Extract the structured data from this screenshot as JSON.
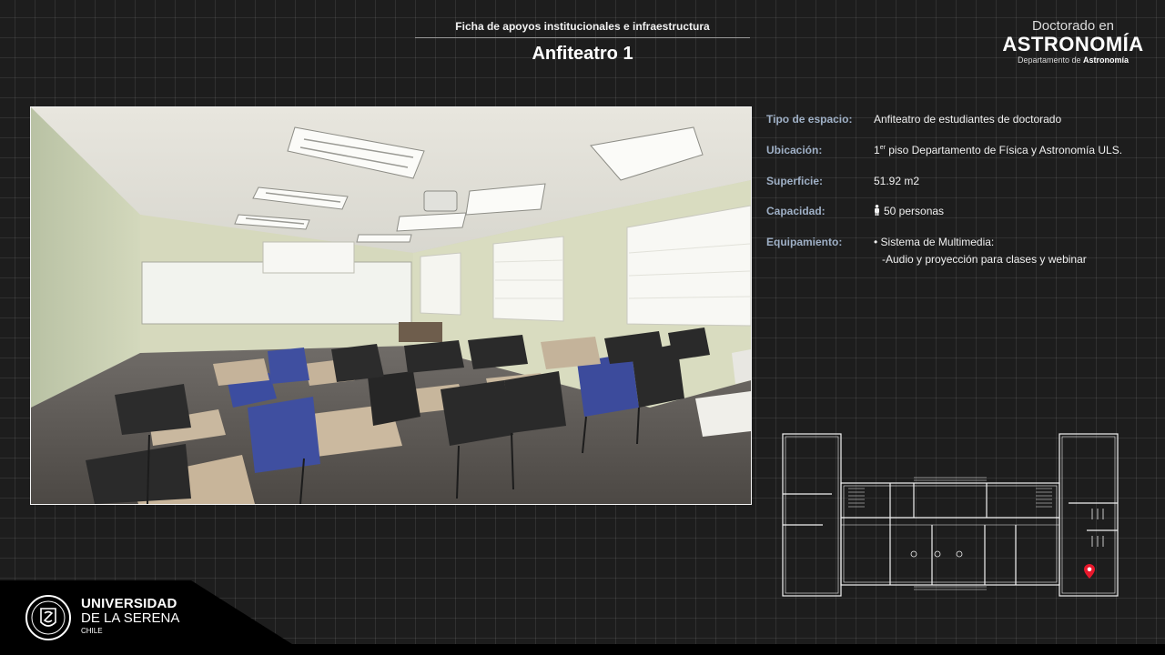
{
  "header": {
    "subtitle": "Ficha de apoyos institucionales e infraestructura",
    "title": "Anfiteatro 1"
  },
  "brand": {
    "line1": "Doctorado en",
    "line2": "ASTRONOMÍA",
    "line3_prefix": "Departamento de ",
    "line3_bold": "Astronomía"
  },
  "photo": {
    "subject": "classroom-photo"
  },
  "details": [
    {
      "label": "Tipo de espacio:",
      "value": "Anfiteatro de estudiantes de doctorado"
    },
    {
      "label": "Ubicación:",
      "value_sup_prefix": "1",
      "value_sup": "er",
      "value": " piso Departamento de Física y Astronomía ULS."
    },
    {
      "label": "Superficie:",
      "value": "51.92 m2"
    },
    {
      "label": "Capacidad:",
      "value": "50 personas",
      "icon": "person-icon"
    },
    {
      "label": "Equipamiento:",
      "value": "• Sistema de Multimedia:",
      "value_line2": "-Audio y proyección para clases y webinar"
    }
  ],
  "floorplan": {
    "marker_icon": "location-pin-icon",
    "marker_color": "#e8182c"
  },
  "footer": {
    "line1": "UNIVERSIDAD",
    "line2": "DE LA SERENA",
    "line3": "CHILE",
    "logo_icon": "university-seal-icon"
  },
  "colors": {
    "background": "#1d1d1d",
    "label": "#9fb0c6",
    "text": "#f0f0f0"
  }
}
